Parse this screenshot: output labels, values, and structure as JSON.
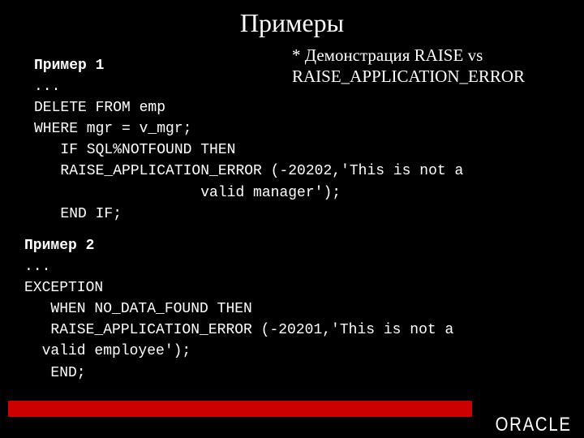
{
  "title": "Примеры",
  "subtitle_line1": "* Демонстрация RAISE vs",
  "subtitle_line2": "  RAISE_APPLICATION_ERROR",
  "example1": {
    "label": "Пример 1",
    "line1": "...",
    "line2": "DELETE FROM emp",
    "line3": "WHERE mgr = v_mgr;",
    "line4": "   IF SQL%NOTFOUND THEN",
    "line5": "   RAISE_APPLICATION_ERROR (-20202,'This is not a",
    "line6": "                   valid manager');",
    "line7": "   END IF;"
  },
  "example2": {
    "label": "Пример 2",
    "line1": "...",
    "line2": "EXCEPTION",
    "line3": "   WHEN NO_DATA_FOUND THEN",
    "line4": "   RAISE_APPLICATION_ERROR (-20201,'This is not a",
    "line5": "  valid employee');",
    "line6": "   END;"
  },
  "brand": "ORACLE"
}
